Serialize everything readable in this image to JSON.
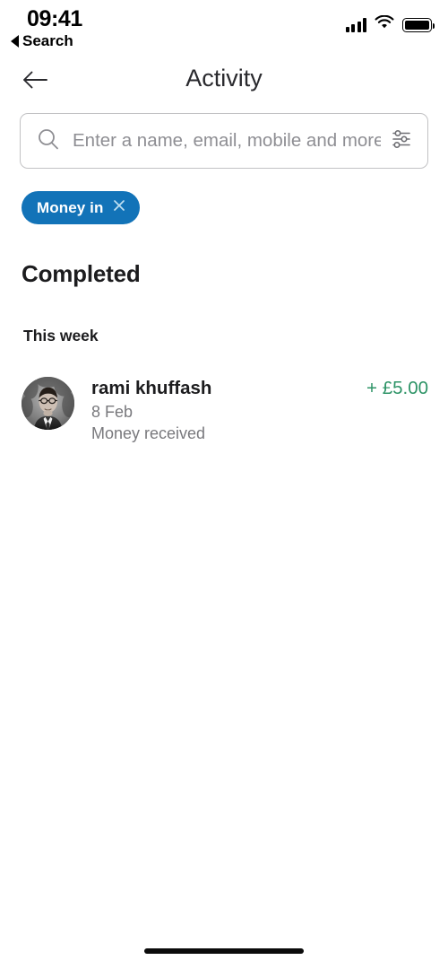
{
  "status_bar": {
    "time": "09:41",
    "back_to_app": "Search",
    "signal_icon": "cellular-signal-icon",
    "wifi_icon": "wifi-icon",
    "battery_icon": "battery-full-icon"
  },
  "nav": {
    "back_icon": "back-arrow-icon",
    "title": "Activity"
  },
  "search": {
    "placeholder": "Enter a name, email, mobile and more",
    "value": "",
    "search_icon": "search-icon",
    "filter_icon": "filter-sliders-icon"
  },
  "filters": {
    "chips": [
      {
        "label": "Money in",
        "remove_icon": "close-icon",
        "color": "#1273b8"
      }
    ]
  },
  "sections": {
    "completed_title": "Completed",
    "groups": [
      {
        "title": "This week",
        "transactions": [
          {
            "name": "rami khuffash",
            "date": "8 Feb",
            "description": "Money received",
            "amount": "+ £5.00",
            "amount_color": "#2e9467",
            "avatar_icon": "user-photo-avatar"
          }
        ]
      }
    ]
  },
  "home_indicator": "home-indicator"
}
